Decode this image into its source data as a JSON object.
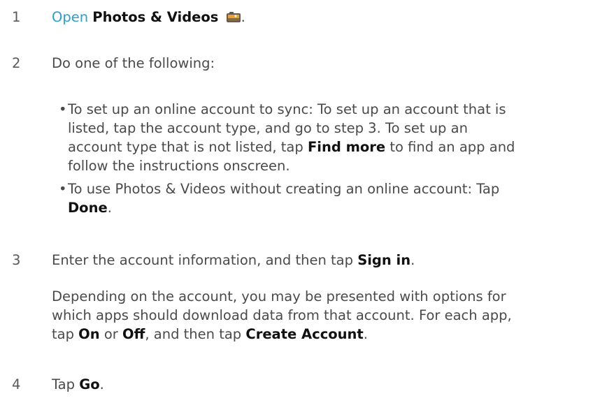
{
  "steps": [
    {
      "number": "1",
      "link": "Open",
      "app_name": "Photos & Videos",
      "icon": "photos-videos-icon",
      "end": "."
    },
    {
      "number": "2",
      "text": "Do one of the following:",
      "bullets": [
        {
          "line1": "To set up an online account to sync: To set up an account that is",
          "line2": "listed, tap the account type, and go to step 3. To set up an",
          "line3_before": "account type that is not listed, tap ",
          "line3_bold": "Find more",
          "line3_after": " to find an app and",
          "line4": "follow the instructions onscreen."
        },
        {
          "line1": "To use Photos & Videos without creating an online account: Tap",
          "line2_bold": "Done",
          "line2_after": "."
        }
      ]
    },
    {
      "number": "3",
      "text_before": "Enter the account information, and then tap ",
      "text_bold": "Sign in",
      "text_after": ".",
      "para_line1": "Depending on the account, you may be presented with options for",
      "para_line2": "which apps should download data from that account. For each app,",
      "para_line3_a": "tap ",
      "para_line3_b": "On",
      "para_line3_c": " or ",
      "para_line3_d": "Off",
      "para_line3_e": ", and then tap ",
      "para_line3_f": "Create Account",
      "para_line3_g": "."
    },
    {
      "number": "4",
      "text_before": "Tap ",
      "text_bold": "Go",
      "text_after": "."
    }
  ]
}
